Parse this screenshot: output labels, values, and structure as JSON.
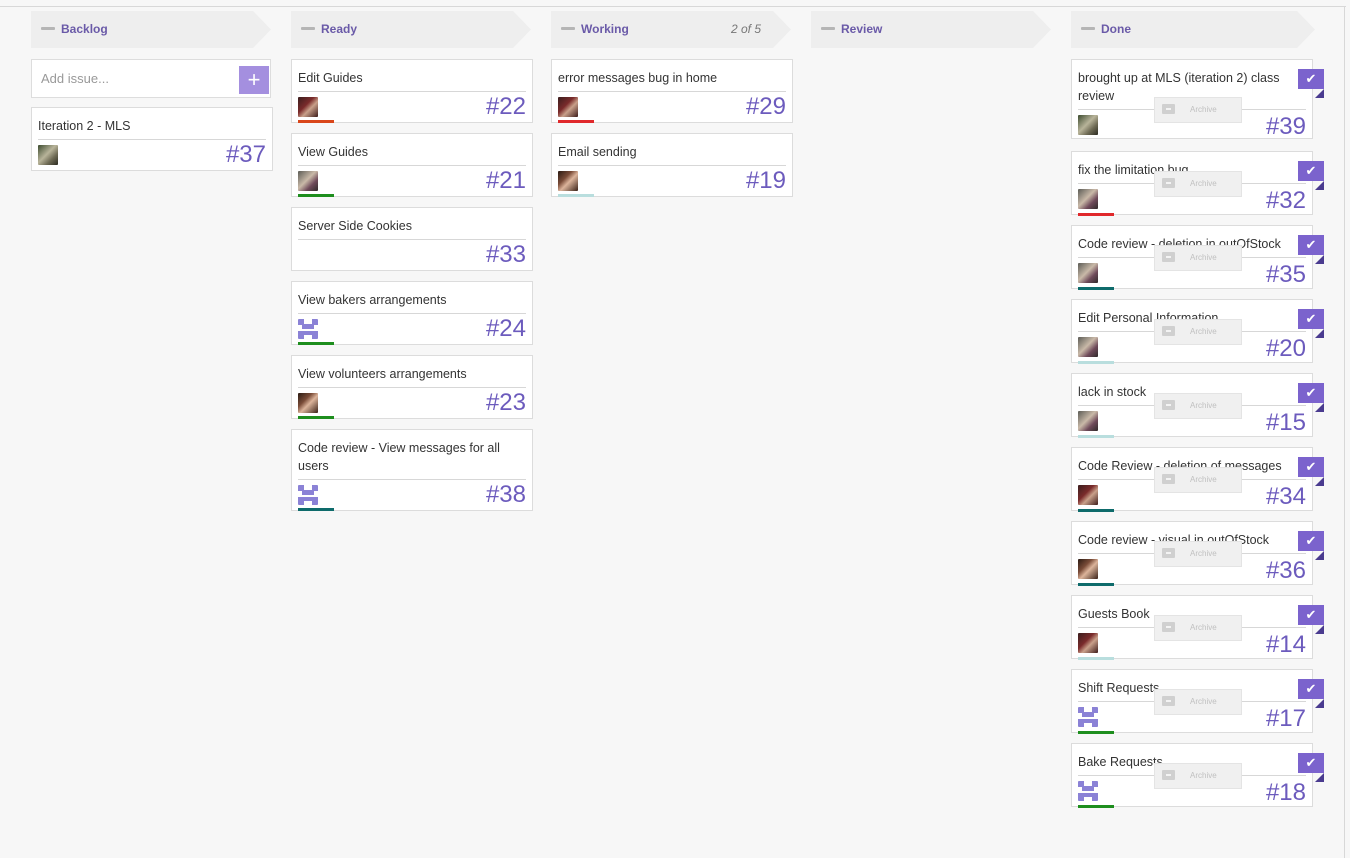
{
  "columns": [
    {
      "title": "Backlog",
      "wip": ""
    },
    {
      "title": "Ready",
      "wip": ""
    },
    {
      "title": "Working",
      "wip": "2 of 5"
    },
    {
      "title": "Review",
      "wip": ""
    },
    {
      "title": "Done",
      "wip": ""
    }
  ],
  "backlog": {
    "add_placeholder": "Add issue...",
    "add_icon": "plus-icon",
    "cards": [
      {
        "title": "Iteration 2 - MLS",
        "number": "#37",
        "avatar": "sloth-photo"
      }
    ]
  },
  "ready": {
    "cards": [
      {
        "title": "Edit Guides",
        "number": "#22",
        "avatar": "photo-red",
        "label_color": "#d9461a"
      },
      {
        "title": "View Guides",
        "number": "#21",
        "avatar": "photo-gray",
        "label_color": "#1e8e1e"
      },
      {
        "title": "Server Side Cookies",
        "number": "#33",
        "avatar": "",
        "label_color": ""
      },
      {
        "title": "View bakers arrangements",
        "number": "#24",
        "avatar": "identicon",
        "label_color": "#1e8e1e"
      },
      {
        "title": "View volunteers arrangements",
        "number": "#23",
        "avatar": "photo-dark",
        "label_color": "#1e8e1e"
      },
      {
        "title": "Code review - View messages for all users",
        "number": "#38",
        "avatar": "identicon",
        "label_color": "#0e6b6b"
      }
    ]
  },
  "working": {
    "cards": [
      {
        "title": "error messages bug in home",
        "number": "#29",
        "avatar": "photo-red",
        "label_color": "#e0282b"
      },
      {
        "title": "Email sending",
        "number": "#19",
        "avatar": "photo-dark",
        "label_color": "#b9dede"
      }
    ]
  },
  "done": {
    "archive_label": "Archive",
    "check_icon": "checkmark-icon",
    "cards": [
      {
        "title": "brought up at MLS (iteration 2) class review",
        "number": "#39",
        "avatar": "sloth-photo",
        "label_color": ""
      },
      {
        "title": "fix the limitation bug",
        "number": "#32",
        "avatar": "photo-gray",
        "label_color": "#e0282b"
      },
      {
        "title": "Code review - deletion in outOfStock",
        "number": "#35",
        "avatar": "photo-gray",
        "label_color": "#0e6b6b"
      },
      {
        "title": "Edit Personal Information",
        "number": "#20",
        "avatar": "photo-gray",
        "label_color": "#b9dede"
      },
      {
        "title": "lack in stock",
        "number": "#15",
        "avatar": "photo-gray",
        "label_color": "#b9dede"
      },
      {
        "title": "Code Review - deletion of messages",
        "number": "#34",
        "avatar": "photo-red",
        "label_color": "#0e6b6b"
      },
      {
        "title": "Code review - visual in outOfStock",
        "number": "#36",
        "avatar": "photo-dark",
        "label_color": "#0e6b6b"
      },
      {
        "title": "Guests Book",
        "number": "#14",
        "avatar": "photo-red",
        "label_color": "#b9dede"
      },
      {
        "title": "Shift Requests",
        "number": "#17",
        "avatar": "identicon",
        "label_color": "#1e8e1e"
      },
      {
        "title": "Bake Requests",
        "number": "#18",
        "avatar": "identicon",
        "label_color": "#1e8e1e"
      }
    ]
  }
}
